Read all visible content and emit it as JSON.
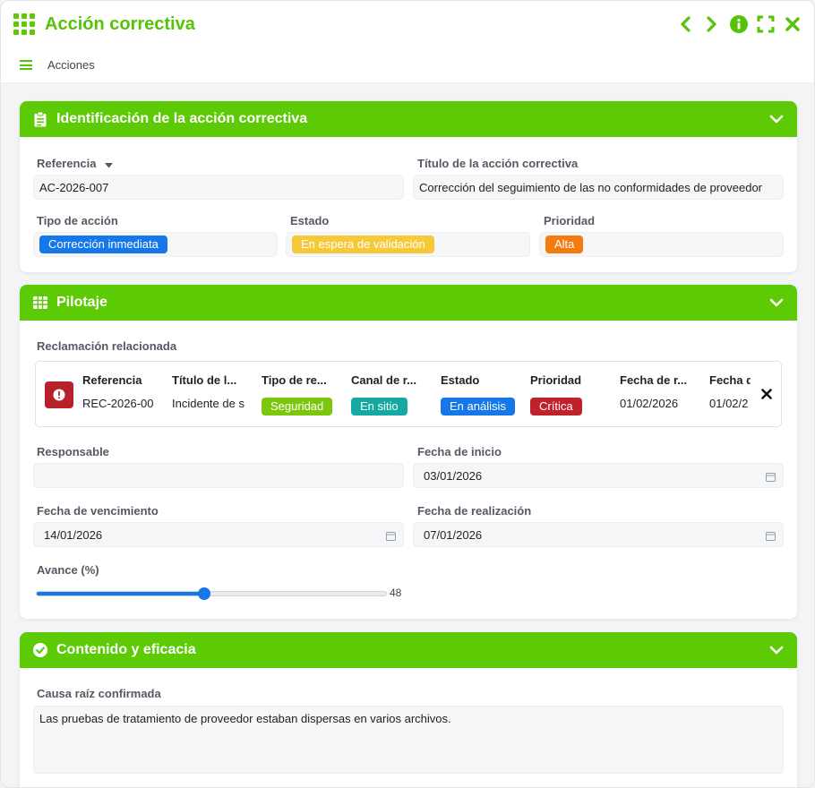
{
  "window": {
    "title": "Acción correctiva"
  },
  "toolbar": {
    "actions_label": "Acciones"
  },
  "section_identification": {
    "title": "Identificación de la acción correctiva",
    "reference_label": "Referencia",
    "reference_value": "AC-2026-007",
    "title_label": "Título de la acción correctiva",
    "title_value": "Corrección del seguimiento de las no conformidades de proveedor",
    "action_type_label": "Tipo de acción",
    "action_type_value": "Corrección inmediata",
    "status_label": "Estado",
    "status_value": "En espera de validación",
    "priority_label": "Prioridad",
    "priority_value": "Alta"
  },
  "section_pilotage": {
    "title": "Pilotaje",
    "related_claim_label": "Reclamación relacionada",
    "related_claim": {
      "columns": [
        "Referencia",
        "Título de l...",
        "Tipo de re...",
        "Canal de r...",
        "Estado",
        "Prioridad",
        "Fecha de r...",
        "Fecha d"
      ],
      "values": [
        "REC-2026-00",
        "Incidente de s",
        "Seguridad",
        "En sitio",
        "En análisis",
        "Crítica",
        "01/02/2026",
        "01/02/2"
      ]
    },
    "responsible_label": "Responsable",
    "responsible_value": "",
    "start_date_label": "Fecha de inicio",
    "start_date_value": "03/01/2026",
    "due_date_label": "Fecha de vencimiento",
    "due_date_value": "14/01/2026",
    "completion_date_label": "Fecha de realización",
    "completion_date_value": "07/01/2026",
    "progress_label": "Avance (%)",
    "progress_value": 48,
    "progress_text": "48"
  },
  "section_content": {
    "title": "Contenido y eficacia",
    "root_cause_label": "Causa raíz confirmada",
    "root_cause_value": "Las pruebas de tratamiento de proveedor estaban dispersas en varios archivos."
  },
  "colors": {
    "brand_green": "#5ccb06",
    "action_type_pill": "#1677e8",
    "status_pill": "#f6c93a",
    "priority_pill": "#f47b10",
    "seguridad_pill": "#7cc70e",
    "en_sitio_pill": "#14a9a3",
    "en_analisis_pill": "#1677e8",
    "critica_pill": "#c0222c",
    "claim_badge": "#b8202a"
  },
  "icons": [
    "apps-grid-icon",
    "chevron-left-icon",
    "chevron-right-icon",
    "info-icon",
    "fullscreen-icon",
    "close-icon",
    "menu-icon",
    "clipboard-icon",
    "table-icon",
    "check-circle-icon",
    "chevron-down-icon",
    "alert-icon",
    "calendar-icon",
    "remove-icon",
    "caret-down-icon"
  ]
}
